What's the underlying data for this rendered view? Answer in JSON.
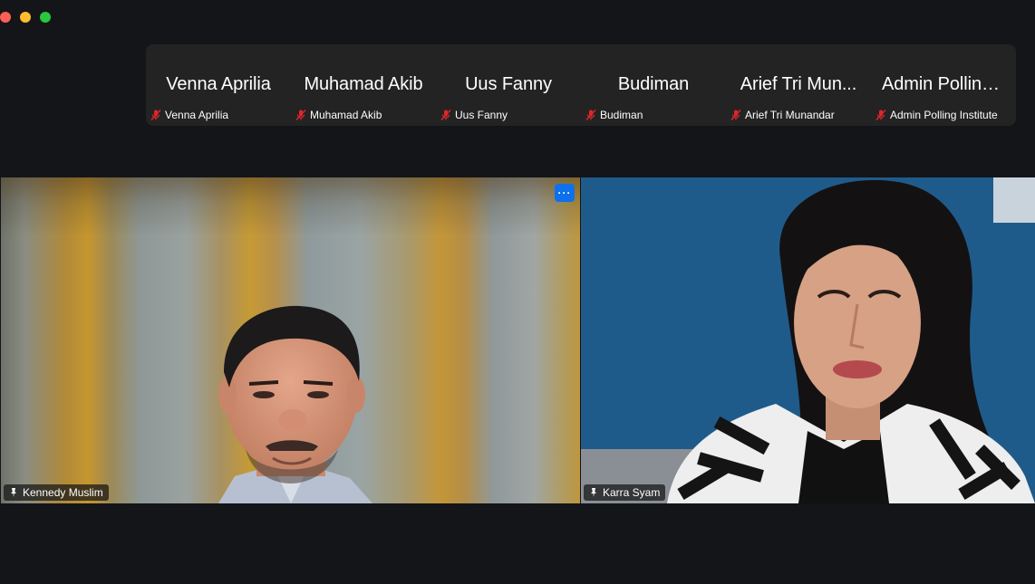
{
  "window": {
    "controls": [
      "close",
      "minimize",
      "maximize"
    ],
    "colors": {
      "close": "#fe5f57",
      "minimize": "#febc2e",
      "maximize": "#28c840"
    }
  },
  "participants": [
    {
      "display": "Venna Aprilia",
      "label": "Venna Aprilia",
      "muted": true
    },
    {
      "display": "Muhamad Akib",
      "label": "Muhamad Akib",
      "muted": true
    },
    {
      "display": "Uus Fanny",
      "label": "Uus Fanny",
      "muted": true
    },
    {
      "display": "Budiman",
      "label": "Budiman",
      "muted": true
    },
    {
      "display": "Arief Tri Mun...",
      "label": "Arief Tri Munandar",
      "muted": true
    },
    {
      "display": "Admin Polling...",
      "label": "Admin Polling Institute",
      "muted": true
    }
  ],
  "videos": {
    "left": {
      "name": "Kennedy Muslim",
      "icon": "pin-icon",
      "more_label": "···"
    },
    "right": {
      "name": "Karra Syam",
      "icon": "pin-icon"
    }
  },
  "colors": {
    "background": "#131519",
    "strip": "#232323",
    "mute_red": "#e0262b",
    "accent_blue": "#0e71eb"
  }
}
